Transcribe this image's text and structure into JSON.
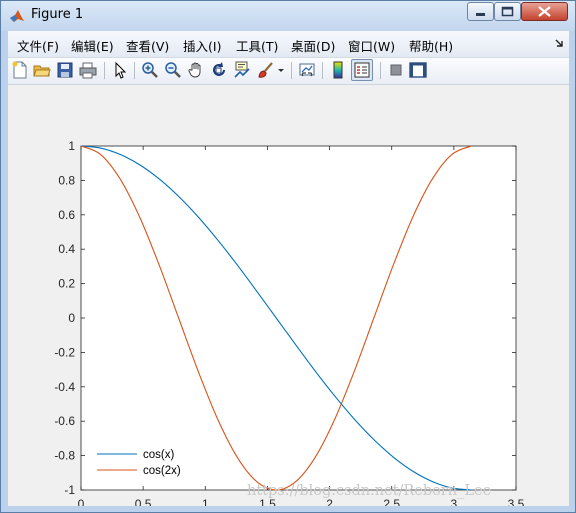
{
  "window": {
    "title": "Figure 1",
    "minimize_label": "Minimize",
    "maximize_label": "Maximize",
    "close_label": "Close"
  },
  "menubar": {
    "items": [
      "文件(F)",
      "编辑(E)",
      "查看(V)",
      "插入(I)",
      "工具(T)",
      "桌面(D)",
      "窗口(W)",
      "帮助(H)"
    ]
  },
  "toolbar": {
    "icons": [
      "new-figure-icon",
      "open-file-icon",
      "save-icon",
      "print-icon",
      "pointer-icon",
      "zoom-in-icon",
      "zoom-out-icon",
      "pan-hand-icon",
      "rotate-3d-icon",
      "data-cursor-icon",
      "brush-icon",
      "brush-dropdown-icon",
      "link-plot-icon",
      "colorbar-icon",
      "legend-icon",
      "hide-plot-tools-icon",
      "show-plot-tools-icon"
    ]
  },
  "colors": {
    "series_cos_x": "#0072bd",
    "series_cos_2x": "#d95319",
    "axes_background": "#ffffff",
    "figure_background": "#f0f0f0"
  },
  "chart_data": {
    "type": "line",
    "xlim": [
      0,
      3.5
    ],
    "ylim": [
      -1,
      1
    ],
    "x_ticks": [
      "0",
      "0.5",
      "1",
      "1.5",
      "2",
      "2.5",
      "3",
      "3.5"
    ],
    "y_ticks": [
      "1",
      "0.8",
      "0.6",
      "0.4",
      "0.2",
      "0",
      "-0.2",
      "-0.4",
      "-0.6",
      "-0.8",
      "-1"
    ],
    "x": [
      0,
      0.1571,
      0.3142,
      0.4712,
      0.6283,
      0.7854,
      0.9425,
      1.0996,
      1.2566,
      1.4137,
      1.5708,
      1.7279,
      1.885,
      2.042,
      2.1991,
      2.3562,
      2.5133,
      2.6704,
      2.8274,
      2.9845,
      3.1416
    ],
    "series": [
      {
        "name": "cos(x)",
        "values": [
          1.0,
          0.988,
          0.951,
          0.891,
          0.809,
          0.707,
          0.588,
          0.454,
          0.309,
          0.156,
          0.0,
          -0.156,
          -0.309,
          -0.454,
          -0.588,
          -0.707,
          -0.809,
          -0.891,
          -0.951,
          -0.988,
          -1.0
        ]
      },
      {
        "name": "cos(2x)",
        "values": [
          1.0,
          0.951,
          0.809,
          0.588,
          0.309,
          0.0,
          -0.309,
          -0.588,
          -0.809,
          -0.951,
          -1.0,
          -0.951,
          -0.809,
          -0.588,
          -0.309,
          0.0,
          0.309,
          0.588,
          0.809,
          0.951,
          1.0
        ]
      }
    ],
    "grid": false,
    "legend_position": "bottom-left"
  },
  "watermark": "https://blog.csdn.net/Reborn_Lee"
}
